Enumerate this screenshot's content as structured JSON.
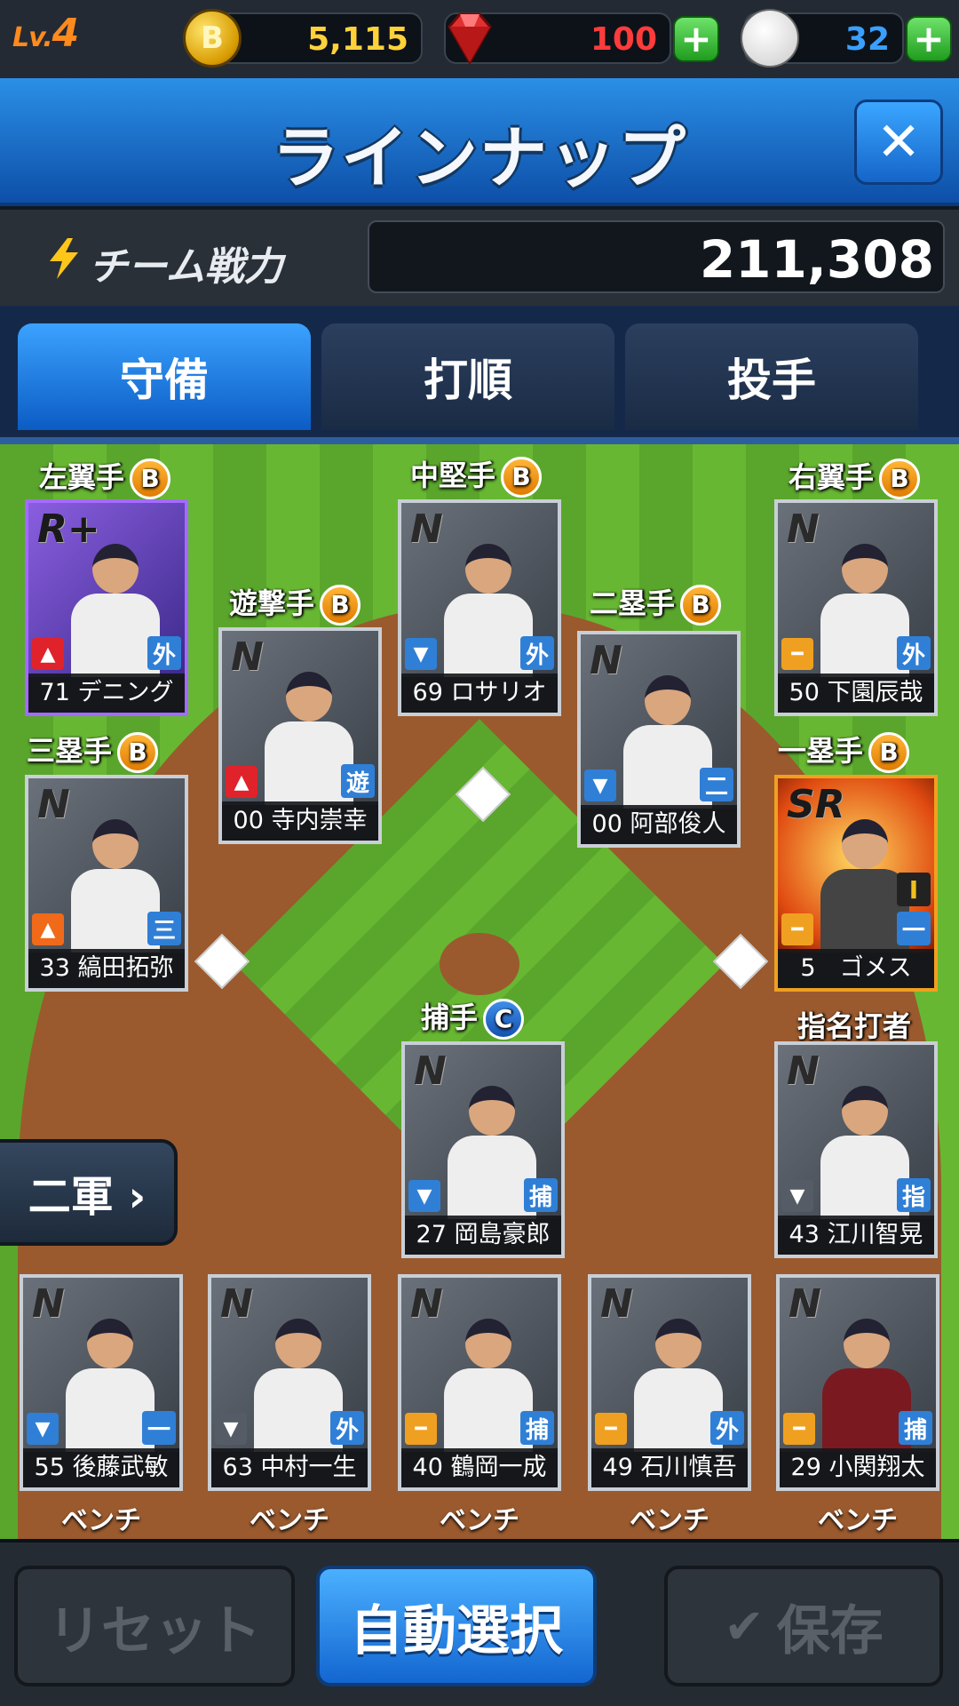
{
  "status": {
    "level_prefix": "Lv.",
    "level": "4",
    "coins": "5,115",
    "coin_symbol": "B",
    "gems": "100",
    "balls": "32",
    "plus": "+"
  },
  "header": {
    "title": "ラインナップ",
    "close": "✕"
  },
  "power": {
    "label": "チーム戦力",
    "value": "211,308"
  },
  "tabs": [
    {
      "label": "守備"
    },
    {
      "label": "打順"
    },
    {
      "label": "投手"
    }
  ],
  "lineup": {
    "lf": {
      "position": "左翼手",
      "grade": "B",
      "rarity": "R+",
      "name": "71 デニング",
      "pos": "外"
    },
    "cf": {
      "position": "中堅手",
      "grade": "B",
      "rarity": "N",
      "name": "69 ロサリオ",
      "pos": "外"
    },
    "rf": {
      "position": "右翼手",
      "grade": "B",
      "rarity": "N",
      "name": "50 下園辰哉",
      "pos": "外"
    },
    "ss": {
      "position": "遊撃手",
      "grade": "B",
      "rarity": "N",
      "name": "00 寺内崇幸",
      "pos": "遊"
    },
    "2b": {
      "position": "二塁手",
      "grade": "B",
      "rarity": "N",
      "name": "00 阿部俊人",
      "pos": "二"
    },
    "3b": {
      "position": "三塁手",
      "grade": "B",
      "rarity": "N",
      "name": "33 縞田拓弥",
      "pos": "三"
    },
    "1b": {
      "position": "一塁手",
      "grade": "B",
      "rarity": "SR",
      "name": "5　ゴメス",
      "pos": "一",
      "extra": "I"
    },
    "c": {
      "position": "捕手",
      "grade": "C",
      "rarity": "N",
      "name": "27 岡島豪郎",
      "pos": "捕"
    },
    "dh": {
      "position": "指名打者",
      "rarity": "N",
      "name": "43 江川智晃",
      "pos": "指"
    }
  },
  "bench": {
    "label": "ベンチ",
    "players": [
      {
        "rarity": "N",
        "name": "55 後藤武敏",
        "pos": "一"
      },
      {
        "rarity": "N",
        "name": "63 中村一生",
        "pos": "外"
      },
      {
        "rarity": "N",
        "name": "40 鶴岡一成",
        "pos": "捕"
      },
      {
        "rarity": "N",
        "name": "49 石川慎吾",
        "pos": "外"
      },
      {
        "rarity": "N",
        "name": "29 小関翔太",
        "pos": "捕"
      }
    ]
  },
  "farm_button": "二軍 ›",
  "buttons": {
    "reset": "リセット",
    "auto": "自動選択",
    "save": "保存",
    "save_icon": "✔"
  },
  "colors": {
    "accent": "#1a7ae6",
    "grade": "#f0a020",
    "field": "#5aa62c"
  }
}
